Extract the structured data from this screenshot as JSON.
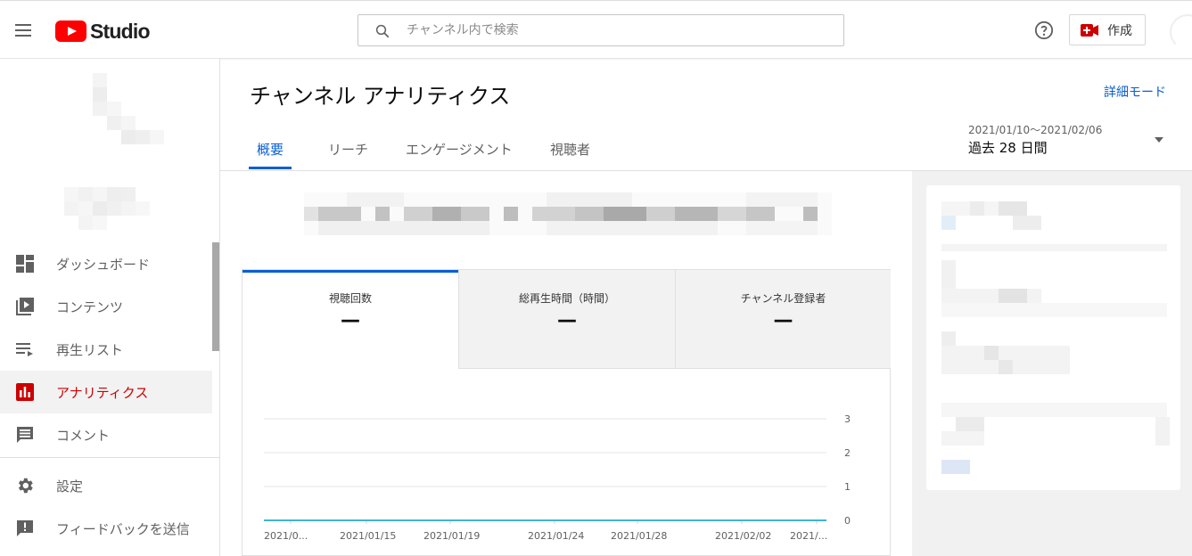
{
  "header": {
    "app_name": "Studio",
    "search_placeholder": "チャンネル内で検索",
    "create_label": "作成",
    "accent": "#ff0000"
  },
  "sidebar": {
    "items": [
      {
        "label": "ダッシュボード",
        "icon": "dashboard-icon",
        "active": false
      },
      {
        "label": "コンテンツ",
        "icon": "content-icon",
        "active": false
      },
      {
        "label": "再生リスト",
        "icon": "playlist-icon",
        "active": false
      },
      {
        "label": "アナリティクス",
        "icon": "analytics-icon",
        "active": true
      },
      {
        "label": "コメント",
        "icon": "comment-icon",
        "active": false
      },
      {
        "label": "設定",
        "icon": "gear-icon",
        "active": false
      },
      {
        "label": "フィードバックを送信",
        "icon": "feedback-icon",
        "active": false
      }
    ],
    "active_color": "#cc0000"
  },
  "main": {
    "title": "チャンネル アナリティクス",
    "advanced_mode": "詳細モード",
    "tabs": [
      {
        "label": "概要",
        "active": true
      },
      {
        "label": "リーチ",
        "active": false
      },
      {
        "label": "エンゲージメント",
        "active": false
      },
      {
        "label": "視聴者",
        "active": false
      }
    ],
    "date_range": "2021/01/10〜2021/02/06",
    "date_period": "過去 28 日間",
    "link_color": "#065fd4"
  },
  "metrics": [
    {
      "label": "視聴回数",
      "value": "—",
      "active": true
    },
    {
      "label": "総再生時間（時間）",
      "value": "—",
      "active": false
    },
    {
      "label": "チャンネル登録者",
      "value": "—",
      "active": false
    }
  ],
  "chart_data": {
    "type": "line",
    "x_tick_labels": [
      "2021/0...",
      "2021/01/15",
      "2021/01/19",
      "2021/01/24",
      "2021/01/28",
      "2021/02/02",
      "2021/..."
    ],
    "y_ticks": [
      0,
      1,
      2,
      3
    ],
    "ylim": [
      0,
      3
    ],
    "series": [
      {
        "values": [
          0,
          0,
          0,
          0,
          0,
          0,
          0
        ],
        "color": "#41b4d0"
      }
    ],
    "grid": true
  }
}
